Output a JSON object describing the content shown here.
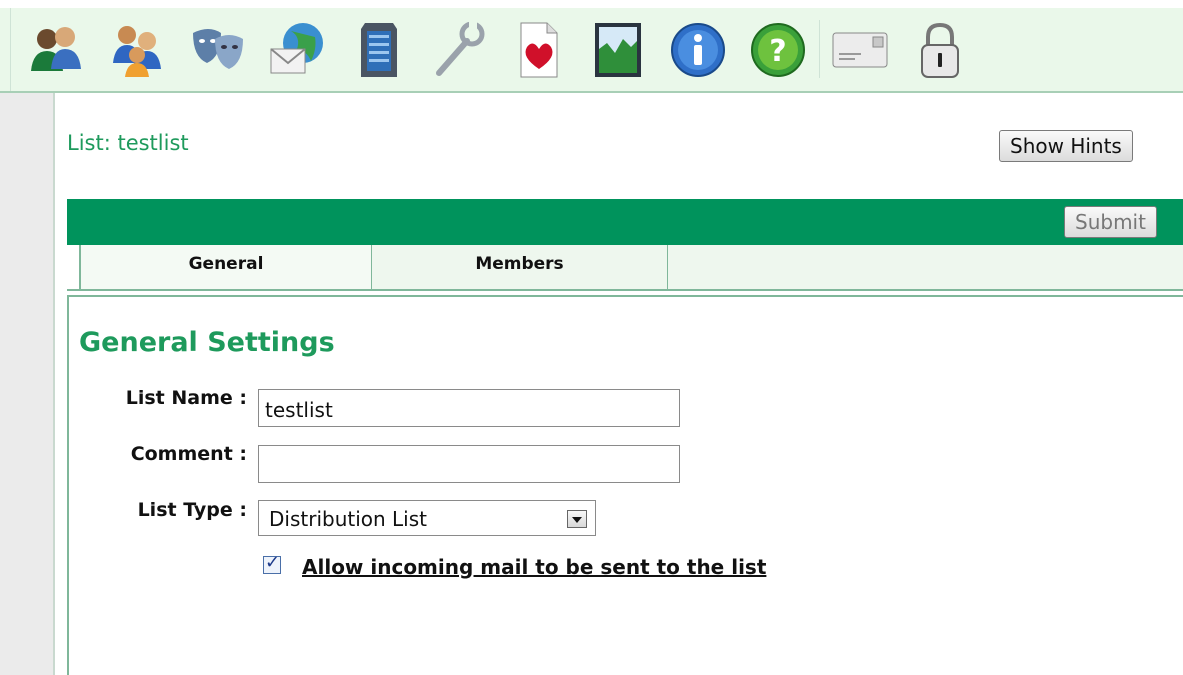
{
  "toolbar": {
    "icons": [
      {
        "name": "users-icon"
      },
      {
        "name": "groups-icon"
      },
      {
        "name": "aliases-icon"
      },
      {
        "name": "domains-icon"
      },
      {
        "name": "server-icon"
      },
      {
        "name": "tools-icon"
      },
      {
        "name": "favorites-icon"
      },
      {
        "name": "statistics-icon"
      },
      {
        "name": "info-icon"
      },
      {
        "name": "help-icon"
      },
      {
        "name": "mailbox-icon"
      },
      {
        "name": "logout-lock-icon"
      }
    ]
  },
  "page": {
    "title": "List: testlist",
    "show_hints_label": "Show Hints",
    "submit_label": "Submit"
  },
  "tabs": [
    {
      "label": "General",
      "active": true
    },
    {
      "label": "Members",
      "active": false
    }
  ],
  "form": {
    "section_title": "General Settings",
    "list_name_label": "List Name :",
    "list_name_value": "testlist",
    "comment_label": "Comment :",
    "comment_value": "",
    "list_type_label": "List Type :",
    "list_type_value": "Distribution List",
    "allow_incoming_label": "Allow incoming mail to be sent to the list",
    "allow_incoming_checked": true
  },
  "colors": {
    "accent_green": "#00935c",
    "title_green": "#1e9a5c",
    "toolbar_bg": "#eaf8ea"
  }
}
